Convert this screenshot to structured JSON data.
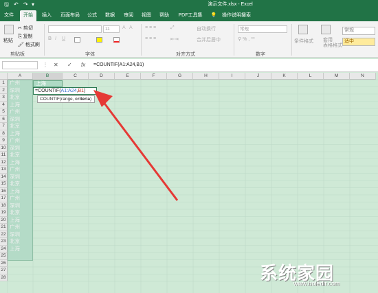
{
  "window": {
    "title": "演示文件.xlsx - Excel"
  },
  "tabs": [
    "文件",
    "开始",
    "插入",
    "页面布局",
    "公式",
    "数据",
    "审阅",
    "视图",
    "帮助",
    "PDF工具集",
    "操作说明搜索"
  ],
  "ribbon": {
    "paste": "粘贴",
    "cut": "剪切",
    "copy": "复制",
    "format_painter": "格式刷",
    "clipboard": "剪贴板",
    "font_group": "字体",
    "font_size": "11",
    "wrap": "自动换行",
    "merge": "合并后居中",
    "align_group": "对齐方式",
    "number_format": "常规",
    "number_group": "数字",
    "cond_format": "条件格式",
    "table_format": "套用\n表格格式",
    "style_normal": "常规",
    "style_medium": "适中"
  },
  "formula_bar": {
    "cancel": "✕",
    "enter": "✓",
    "fx": "fx",
    "value": "=COUNTIF(A1:A24,B1)"
  },
  "columns": [
    "A",
    "B",
    "C",
    "D",
    "E",
    "F",
    "G",
    "H",
    "I",
    "J",
    "K",
    "L",
    "M",
    "N"
  ],
  "rows": [
    "1",
    "2",
    "3",
    "4",
    "5",
    "6",
    "7",
    "8",
    "9",
    "10",
    "11",
    "12",
    "13",
    "14",
    "15",
    "16",
    "17",
    "18",
    "19",
    "20",
    "21",
    "22",
    "23",
    "24",
    "25",
    "26",
    "27",
    "28"
  ],
  "column_a": [
    "广州",
    "深圳",
    "北京",
    "上海",
    "广州",
    "深圳",
    "北京",
    "上海",
    "广州",
    "深圳",
    "北京",
    "上海",
    "广州",
    "深圳",
    "北京",
    "上海",
    "广州",
    "深圳",
    "北京",
    "上海",
    "广州",
    "深圳",
    "北京",
    "上海"
  ],
  "cell_b1": "上海",
  "cell_b2": {
    "prefix": "=COUNTIF(",
    "range": "A1:A24",
    "comma": ",",
    "arg": "B1",
    "suffix": ")"
  },
  "tooltip": {
    "text": "COUNTIF(range, ",
    "bold": "criteria",
    "close": ")"
  },
  "watermark": {
    "title": "系统家园",
    "url": "www.boledir.com"
  },
  "colors": {
    "excel_green": "#217346",
    "arrow_red": "#e53935",
    "selection_green": "#cfe9d6"
  }
}
